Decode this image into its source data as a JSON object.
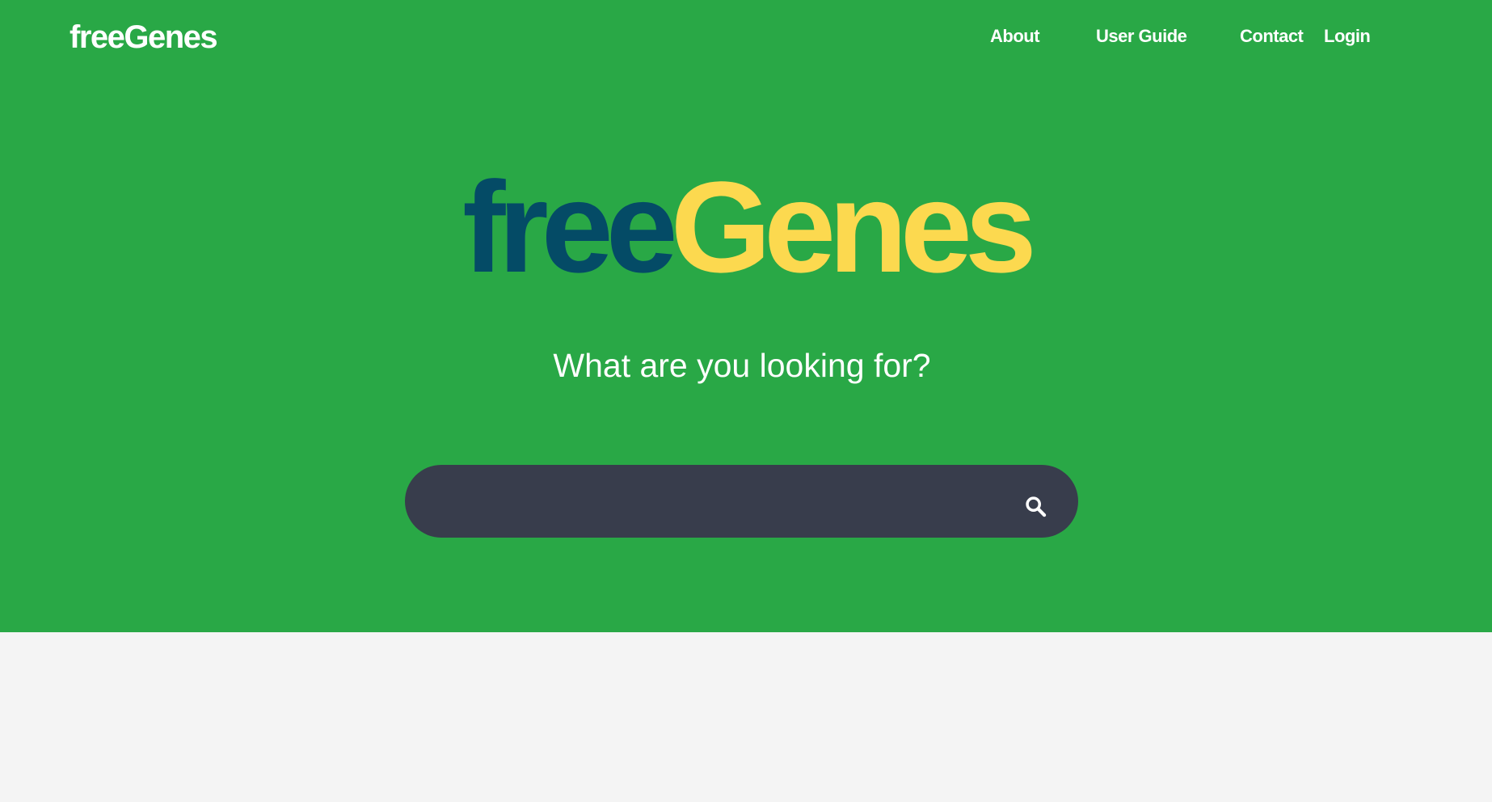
{
  "header": {
    "brand": "freeGenes",
    "nav": [
      {
        "label": "About"
      },
      {
        "label": "User Guide"
      },
      {
        "label": "Contact"
      },
      {
        "label": "Login"
      }
    ]
  },
  "hero": {
    "logo_part1": "free",
    "logo_part2": "Genes",
    "tagline": "What are you looking for?",
    "search": {
      "placeholder": "",
      "value": "",
      "icon": "search-icon"
    }
  },
  "colors": {
    "hero_background": "#29a846",
    "logo_free": "#044b66",
    "logo_genes": "#fcd94f",
    "search_bar": "#383d4c",
    "page_background": "#f4f4f4",
    "text_light": "#ffffff"
  }
}
